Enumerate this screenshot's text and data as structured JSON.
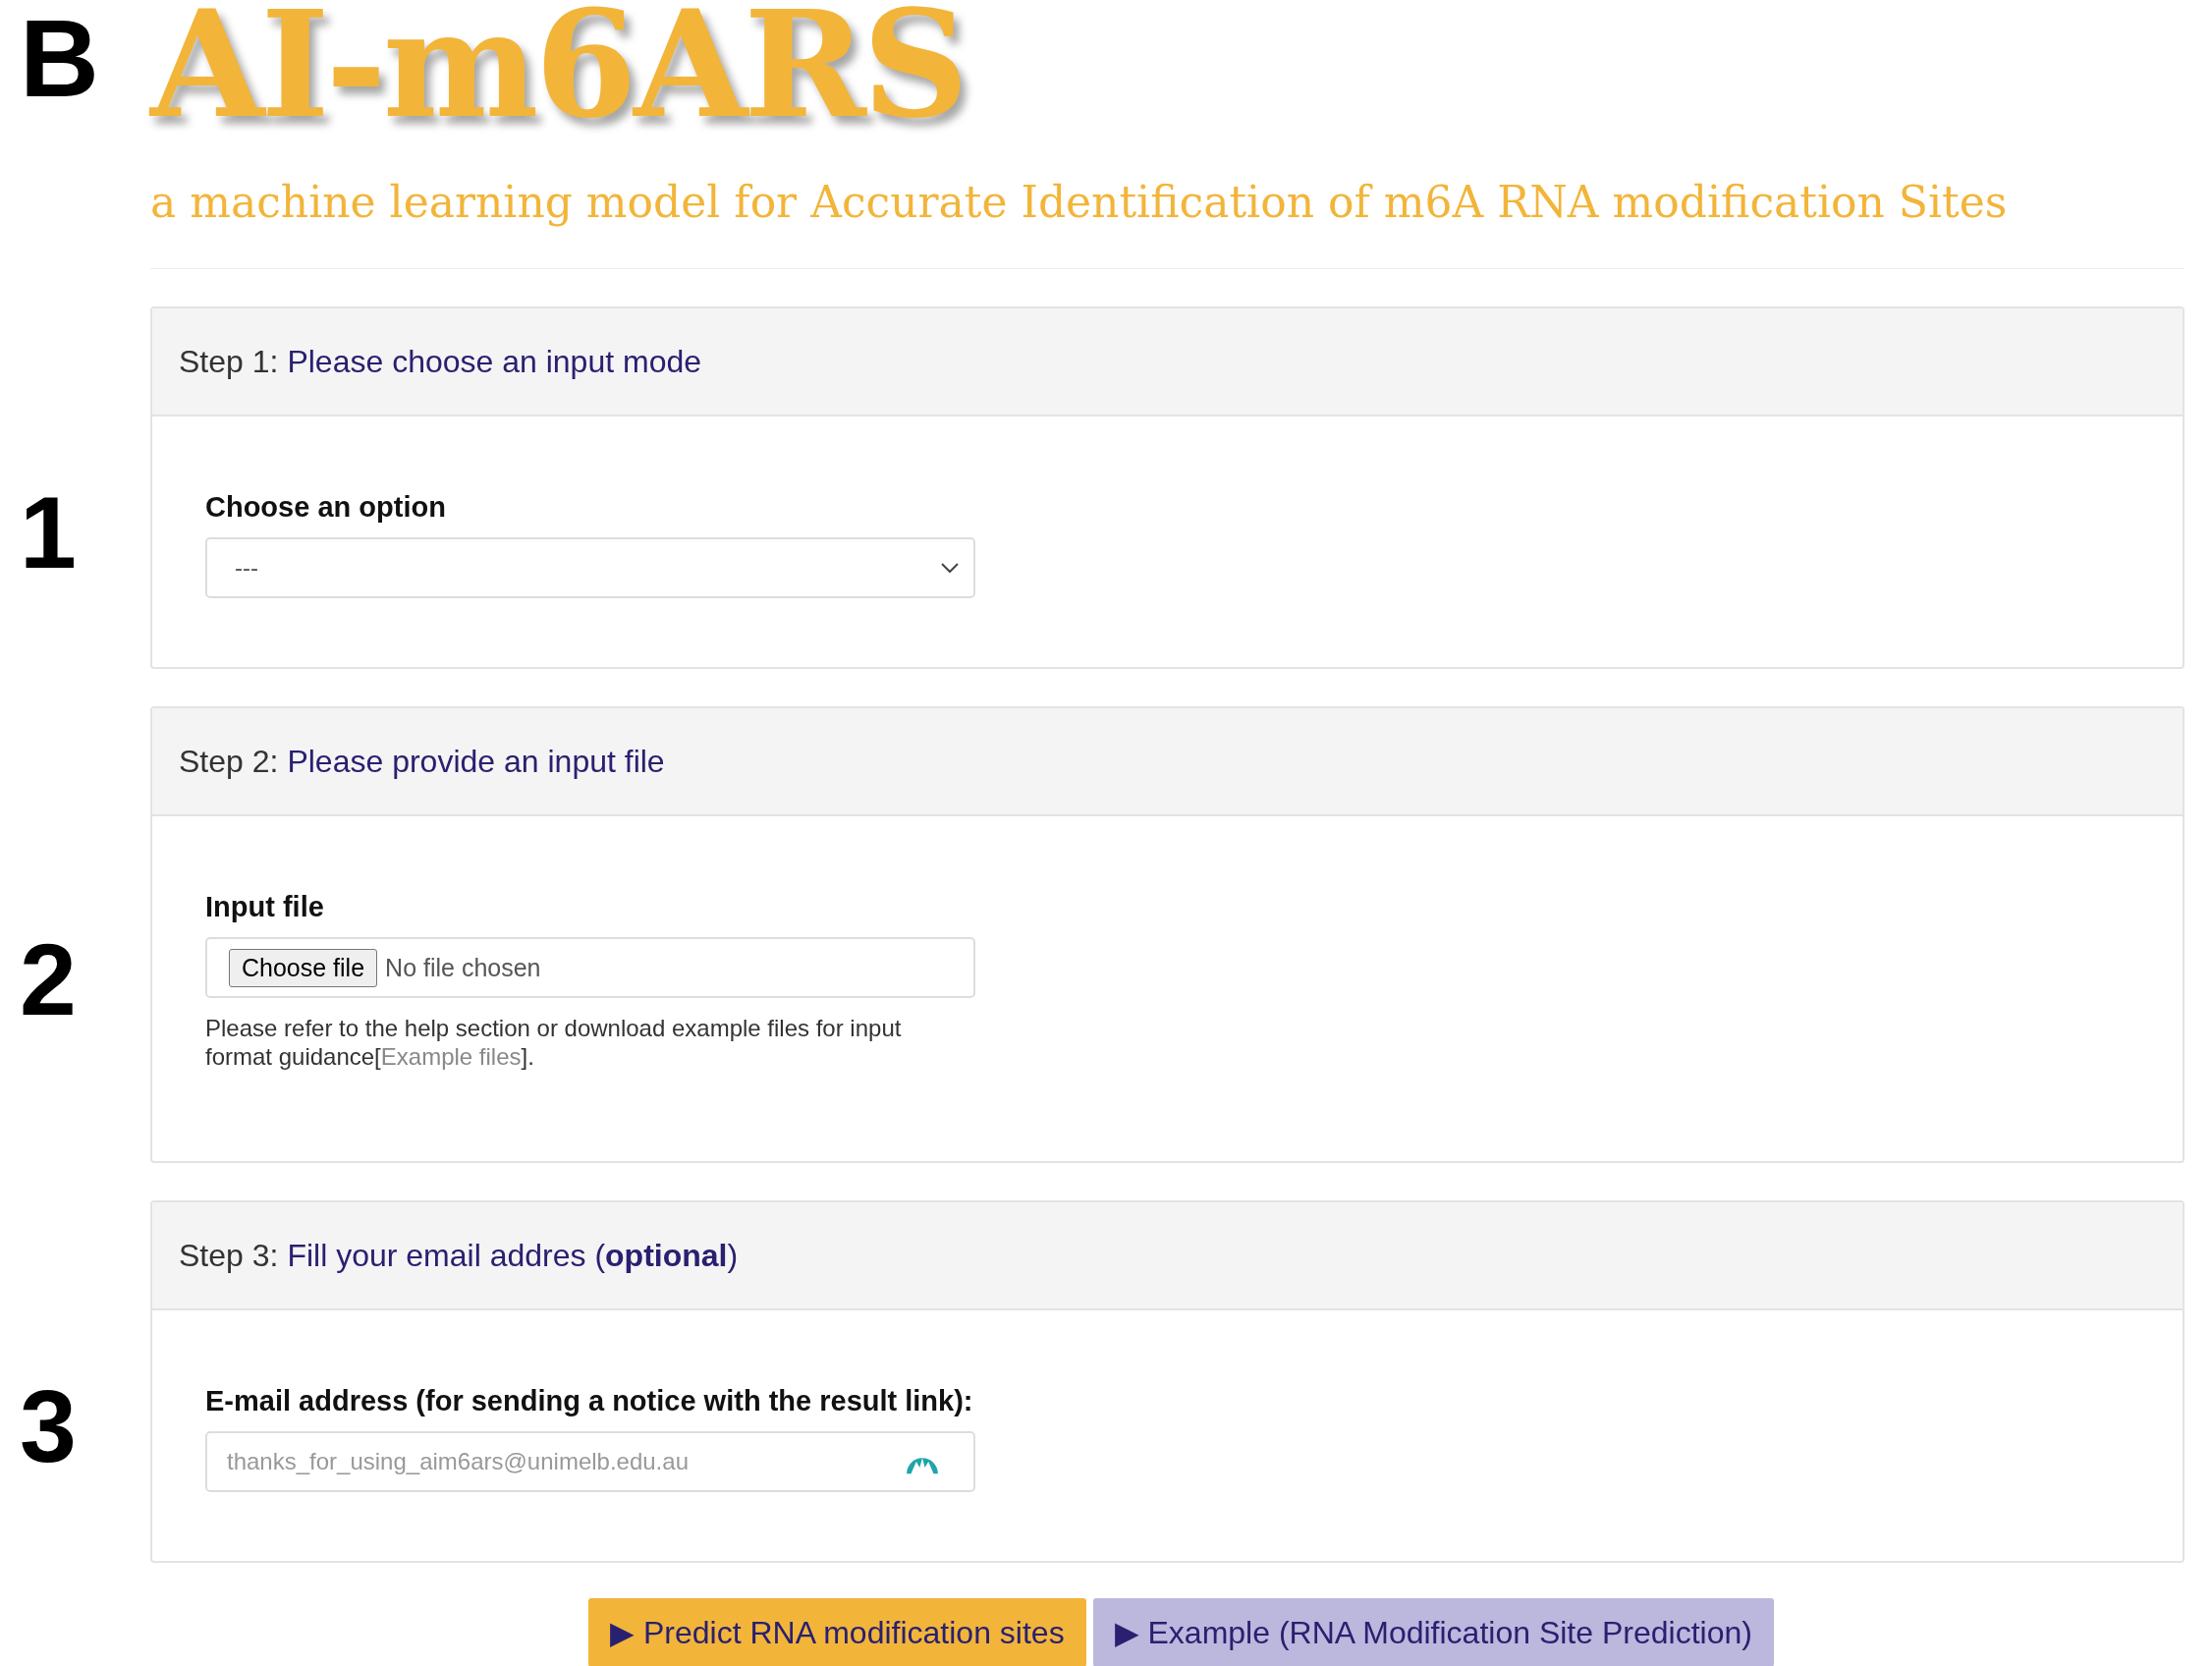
{
  "figure_label": "B",
  "title": "AI-m6ARS",
  "subtitle": "a machine learning model for Accurate Identification of m6A RNA modification Sites",
  "steps": [
    {
      "figure_label": "1",
      "prefix": "Step 1:",
      "heading": "Please choose an input mode",
      "field_label": "Choose an option",
      "kind": "select",
      "value": "---"
    },
    {
      "figure_label": "2",
      "prefix": "Step 2:",
      "heading": "Please provide an input file",
      "field_label": "Input file",
      "kind": "file",
      "button": "Choose file",
      "status": "No file chosen",
      "help_before": "Please refer to the help section or download example files for input format guidance[",
      "help_link": "Example files",
      "help_after": "]."
    },
    {
      "figure_label": "3",
      "prefix": "Step 3:",
      "heading": "Fill your email addres (**optional**)",
      "field_label": "E-mail address (for sending a notice with the result link):",
      "kind": "email",
      "placeholder": "thanks_for_using_aim6ars@unimelb.edu.au"
    }
  ],
  "buttons": [
    {
      "label": "▶ Predict RNA modification sites",
      "kind": "primary"
    },
    {
      "label": "▶ Example (RNA Modification Site Prediction)",
      "kind": "secondary"
    }
  ]
}
